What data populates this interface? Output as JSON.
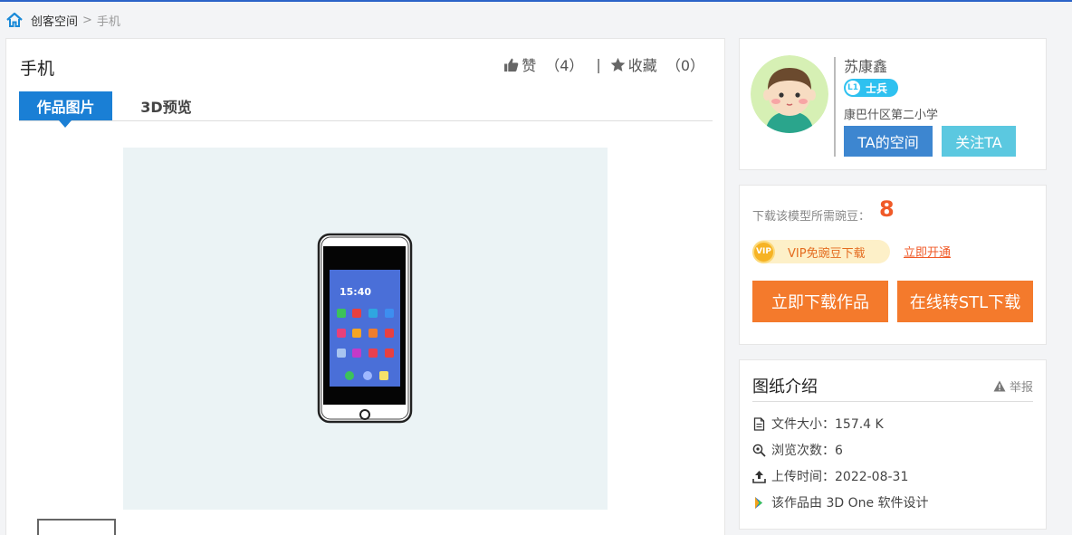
{
  "breadcrumb": {
    "home": "创客空间",
    "separator": ">",
    "current": "手机"
  },
  "work": {
    "title": "手机"
  },
  "stats": {
    "like_label": "赞",
    "like_count": "（4）",
    "divider": "|",
    "fav_label": "收藏",
    "fav_count": "（0）"
  },
  "tabs": [
    {
      "label": "作品图片"
    },
    {
      "label": "3D预览"
    }
  ],
  "user": {
    "name": "苏康鑫",
    "level_tag": "L1",
    "level_name": "士兵",
    "school": "康巴什区第二小学",
    "space_button": "TA的空间",
    "follow_button": "关注TA"
  },
  "download": {
    "cost_label": "下载该模型所需豌豆：",
    "cost_value": "8",
    "vip_icon_text": "VIP",
    "vip_text": "VIP免豌豆下载",
    "vip_open": "立即开通",
    "download_button": "立即下载作品",
    "stl_button": "在线转STL下载"
  },
  "intro": {
    "title": "图纸介绍",
    "report": "举报",
    "file_size": "文件大小：157.4 K",
    "views": "浏览次数：6",
    "upload_time": "上传时间：2022-08-31",
    "software": "该作品由 3D One 软件设计"
  },
  "phone_screen": {
    "time": "15:40"
  },
  "colors": {
    "accent": "#1a7fd5",
    "orange": "#f47a2c",
    "cyan": "#5bc8e0",
    "blue_btn": "#3d86d0"
  }
}
